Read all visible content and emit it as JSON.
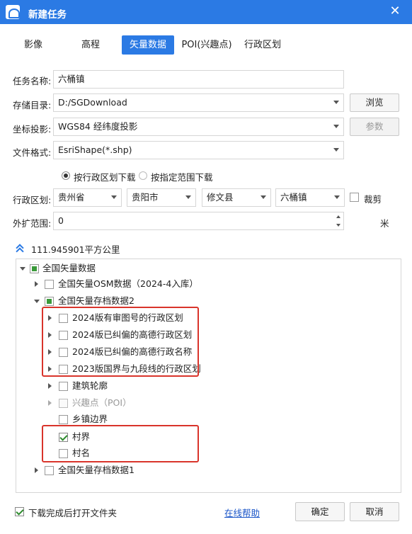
{
  "window": {
    "title": "新建任务",
    "close": "✕"
  },
  "tabs": [
    {
      "label": "影像",
      "active": false
    },
    {
      "label": "高程",
      "active": false
    },
    {
      "label": "矢量数据",
      "active": true
    },
    {
      "label": "POI(兴趣点)",
      "active": false
    },
    {
      "label": "行政区划",
      "active": false
    }
  ],
  "form": {
    "task_name": {
      "label": "任务名称:",
      "value": "六桶镇"
    },
    "storage_dir": {
      "label": "存储目录:",
      "value": "D:/SGDownload",
      "button": "浏览"
    },
    "projection": {
      "label": "坐标投影:",
      "value": "WGS84 经纬度投影",
      "button": "参数"
    },
    "file_format": {
      "label": "文件格式:",
      "value": "EsriShape(*.shp)"
    },
    "mode": {
      "option_admin": "按行政区划下载",
      "option_range": "按指定范围下载",
      "selected": "按行政区划下载"
    },
    "admin_region": {
      "label": "行政区划:",
      "province": "贵州省",
      "city": "贵阳市",
      "county": "修文县",
      "town": "六桶镇",
      "clip_label": "裁剪"
    },
    "buffer": {
      "label": "外扩范围:",
      "value": "0",
      "unit": "米"
    }
  },
  "area": {
    "text": "111.945901平方公里"
  },
  "tree": [
    {
      "label": "全国矢量数据",
      "state": "partial",
      "expanded": true
    },
    {
      "label": "全国矢量OSM数据（2024-4入库）",
      "state": "unchecked",
      "expanded": false
    },
    {
      "label": "全国矢量存档数据2",
      "state": "partial",
      "expanded": true
    },
    {
      "label": "2024版有审图号的行政区划",
      "state": "unchecked",
      "expanded": false
    },
    {
      "label": "2024版已纠偏的高德行政区划",
      "state": "unchecked",
      "expanded": false
    },
    {
      "label": "2024版已纠偏的高德行政名称",
      "state": "unchecked",
      "expanded": false
    },
    {
      "label": "2023版国界与九段线的行政区划",
      "state": "unchecked",
      "expanded": false
    },
    {
      "label": "建筑轮廓",
      "state": "unchecked",
      "expanded": false
    },
    {
      "label": "兴趣点（POI）",
      "state": "disabled",
      "expanded": false
    },
    {
      "label": "乡镇边界",
      "state": "unchecked"
    },
    {
      "label": "村界",
      "state": "checked"
    },
    {
      "label": "村名",
      "state": "unchecked"
    },
    {
      "label": "全国矢量存档数据1",
      "state": "unchecked",
      "expanded": false
    }
  ],
  "footer": {
    "open_folder_label": "下载完成后打开文件夹",
    "open_folder_checked": true,
    "help_link": "在线帮助",
    "ok": "确定",
    "cancel": "取消"
  },
  "colors": {
    "accent": "#2b7ae4",
    "highlight_box": "#d9342b",
    "check_green": "#3a9a3a"
  }
}
